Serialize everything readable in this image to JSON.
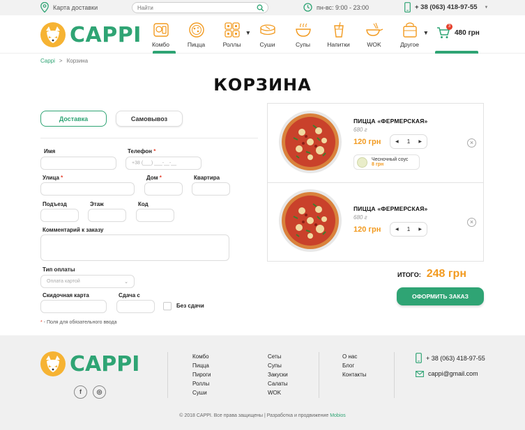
{
  "topbar": {
    "map_label": "Карта доставки",
    "search_placeholder": "Найти",
    "hours": "пн-вс: 9:00 - 23:00",
    "phone": "+ 38 (063) 418-97-55"
  },
  "header": {
    "logo_text": "CAPPI",
    "nav": [
      {
        "label": "Комбо",
        "icon": "combo-icon"
      },
      {
        "label": "Пицца",
        "icon": "pizza-icon"
      },
      {
        "label": "Роллы",
        "icon": "rolls-icon"
      },
      {
        "label": "Суши",
        "icon": "sushi-icon"
      },
      {
        "label": "Супы",
        "icon": "soup-icon"
      },
      {
        "label": "Напитки",
        "icon": "drinks-icon"
      },
      {
        "label": "WOK",
        "icon": "wok-icon"
      },
      {
        "label": "Другое",
        "icon": "other-icon"
      }
    ],
    "cart_count": "3",
    "cart_total": "480 грн"
  },
  "breadcrumb": {
    "home": "Cappi",
    "sep": ">",
    "current": "Корзина"
  },
  "page_title": "КОРЗИНА",
  "delivery": {
    "active": "Доставка",
    "inactive": "Самовывоз"
  },
  "form": {
    "name_label": "Имя",
    "phone_label": "Телефон",
    "phone_placeholder": "+38 (___) ___-__-__",
    "street_label": "Улица",
    "house_label": "Дом",
    "apartment_label": "Квартира",
    "entrance_label": "Подъезд",
    "floor_label": "Этаж",
    "code_label": "Код",
    "comment_label": "Комментарий к заказу",
    "payment_label": "Тип оплаты",
    "payment_value": "Оплата картой",
    "discount_label": "Скидочная карта",
    "change_label": "Сдача с",
    "no_change_label": "Без сдачи",
    "required_star": "*",
    "required_note": " - Поля для обязательного ввода"
  },
  "cart": {
    "items": [
      {
        "name": "ПИЦЦА «ФЕРМЕРСКАЯ»",
        "weight": "680 г",
        "price": "120 грн",
        "qty": "1",
        "sauce_name": "Чесночный соус",
        "sauce_price": "8 грн"
      },
      {
        "name": "ПИЦЦА «ФЕРМЕРСКАЯ»",
        "weight": "680 г",
        "price": "120 грн",
        "qty": "1"
      }
    ],
    "total_label": "ИТОГО:",
    "total_value": "248 грн",
    "order_button": "ОФОРМИТЬ ЗАКАЗ"
  },
  "footer": {
    "logo_text": "CAPPI",
    "col1": [
      "Комбо",
      "Пицца",
      "Пироги",
      "Роллы",
      "Суши"
    ],
    "col2": [
      "Сеты",
      "Супы",
      "Закуски",
      "Салаты",
      "WOK"
    ],
    "col3": [
      "О нас",
      "Блог",
      "Контакты"
    ],
    "phone": "+ 38 (063) 418-97-55",
    "email": "cappi@gmail.com",
    "copyright": "© 2018 CAPPI. Все права защищены | Разработка и продвижение",
    "dev": "Mobios",
    "social": [
      "facebook-icon",
      "instagram-icon"
    ]
  },
  "colors": {
    "brand_green": "#2fa474",
    "accent_orange": "#f29a1f",
    "logo_yellow": "#f6b333",
    "error_red": "#e5412d"
  }
}
